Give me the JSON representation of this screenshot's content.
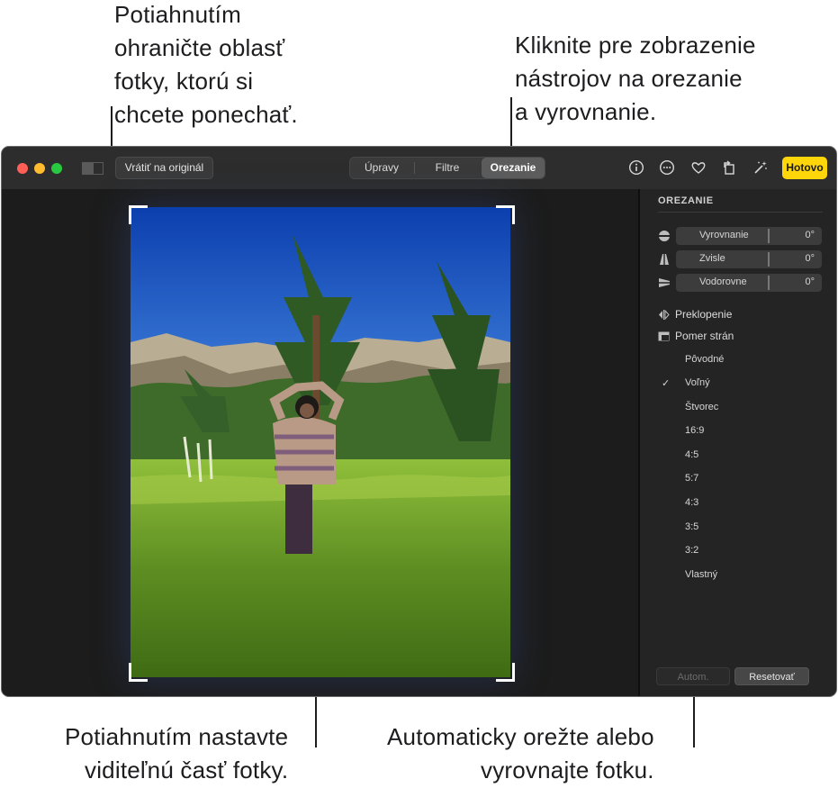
{
  "callouts": {
    "top_left": [
      "Potiahnutím",
      "ohraničte oblasť",
      "fotky, ktorú si",
      "chcete ponechať."
    ],
    "top_right": [
      "Kliknite pre zobrazenie",
      "nástrojov na orezanie",
      "a vyrovnanie."
    ],
    "bottom_left": [
      "Potiahnutím nastavte",
      "viditeľnú časť fotky."
    ],
    "bottom_right": [
      "Automaticky orežte alebo",
      "vyrovnajte fotku."
    ]
  },
  "toolbar": {
    "revert_label": "Vrátiť na originál",
    "tabs": [
      "Úpravy",
      "Filtre",
      "Orezanie"
    ],
    "active_tab": "Orezanie",
    "done_label": "Hotovo",
    "done_color": "#ffd60a",
    "icons": [
      "info-icon",
      "more-icon",
      "heart-icon",
      "rotate-icon",
      "magic-wand-icon"
    ]
  },
  "sidebar": {
    "title": "OREZANIE",
    "sliders": [
      {
        "label": "Vyrovnanie",
        "value": "0°",
        "icon": "straighten-icon"
      },
      {
        "label": "Zvisle",
        "value": "0°",
        "icon": "vertical-icon"
      },
      {
        "label": "Vodorovne",
        "value": "0°",
        "icon": "horizontal-icon"
      }
    ],
    "flip_label": "Preklopenie",
    "aspect_label": "Pomer strán",
    "ratios": [
      "Pôvodné",
      "Voľný",
      "Štvorec",
      "16:9",
      "4:5",
      "5:7",
      "4:3",
      "3:5",
      "3:2",
      "Vlastný"
    ],
    "selected_ratio": "Voľný",
    "check_mark": "✓",
    "auto_label": "Autom.",
    "reset_label": "Resetovať"
  }
}
